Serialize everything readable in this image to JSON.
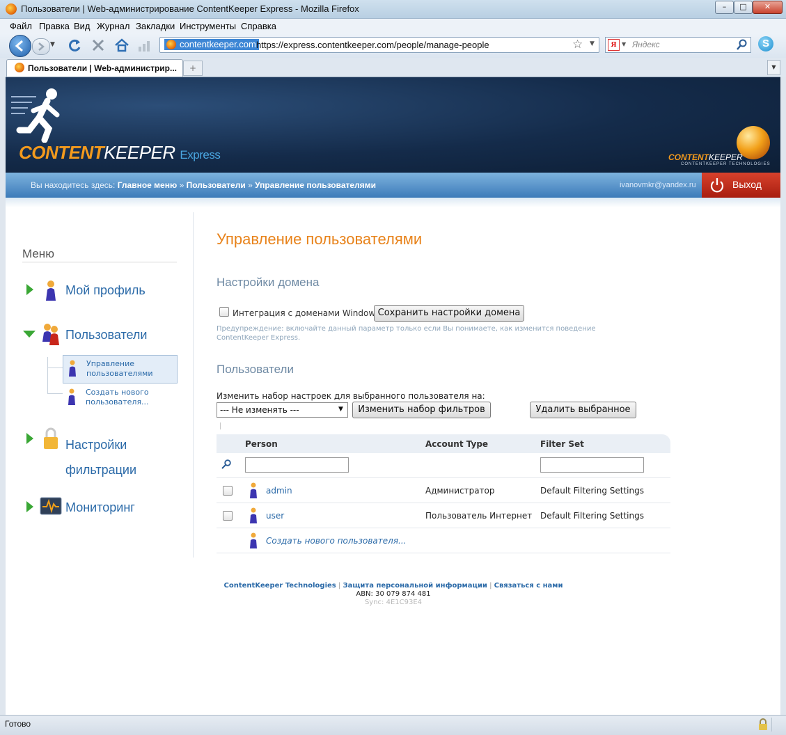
{
  "window": {
    "title": "Пользователи | Web-администрирование ContentKeeper Express - Mozilla Firefox",
    "minimize": "–",
    "maximize": "□",
    "close": "✕"
  },
  "menubar": [
    "Файл",
    "Правка",
    "Вид",
    "Журнал",
    "Закладки",
    "Инструменты",
    "Справка"
  ],
  "navbar": {
    "site_badge": "contentkeeper.com",
    "url": "https://express.contentkeeper.com/people/manage-people",
    "search_placeholder": "Яндекс"
  },
  "tab": {
    "label": "Пользователи | Web-администрир..."
  },
  "header": {
    "brand_content": "CONTENT",
    "brand_keeper": "KEEPER",
    "brand_express": "Express",
    "corner_brand_content": "CONTENT",
    "corner_brand_keeper": "KEEPER",
    "corner_brand_sub": "CONTENTKEEPER TECHNOLOGIES"
  },
  "breadcrumb": {
    "prefix": "Вы находитесь здесь:",
    "item1": "Главное меню",
    "sep": "»",
    "item2": "Пользователи",
    "item3": "Управление пользователями"
  },
  "user_email": "ivanovmkr@yandex.ru",
  "logout_label": "Выход",
  "sidebar": {
    "heading": "Меню",
    "my_profile": "Мой профиль",
    "users": "Пользователи",
    "sub_manage_line1": "Управление",
    "sub_manage_line2": "пользователями",
    "sub_create_line1": "Создать нового",
    "sub_create_line2": "пользователя...",
    "filter_line1": "Настройки",
    "filter_line2": "фильтрации",
    "monitoring": "Мониторинг"
  },
  "main": {
    "title": "Управление пользователями",
    "domain_heading": "Настройки домена",
    "domain_checkbox_label": "Интеграция с доменами Windows",
    "save_domain_button": "Сохранить настройки домена",
    "warning_line1": "Предупреждение: включайте данный параметр только если Вы понимаете, как изменится поведение",
    "warning_line2": "ContentKeeper Express.",
    "users_heading": "Пользователи",
    "change_set_label": "Изменить набор настроек для выбранного пользователя на:",
    "select_value": "--- Не изменять ---",
    "change_filters_button": "Изменить набор фильтров",
    "delete_selected_button": "Удалить выбранное",
    "columns": [
      "Person",
      "Account Type",
      "Filter Set"
    ],
    "rows": [
      {
        "person": "admin",
        "type": "Администратор",
        "filter": "Default Filtering Settings"
      },
      {
        "person": "user",
        "type": "Пользователь Интернет",
        "filter": "Default Filtering Settings"
      }
    ],
    "create_new_user": "Создать нового пользователя..."
  },
  "footer": {
    "link1": "ContentKeeper Technologies",
    "sep": "|",
    "link2": "Защита персональной информации",
    "link3": "Связаться с нами",
    "abn": "ABN: 30 079 874 481",
    "sync": "Sync: 4E1C93E4"
  },
  "status": "Готово",
  "colors": {
    "accent_orange": "#e8831b",
    "link_blue": "#2b6aa8",
    "header_navy": "#142b4a",
    "logout_red": "#c2301d"
  }
}
